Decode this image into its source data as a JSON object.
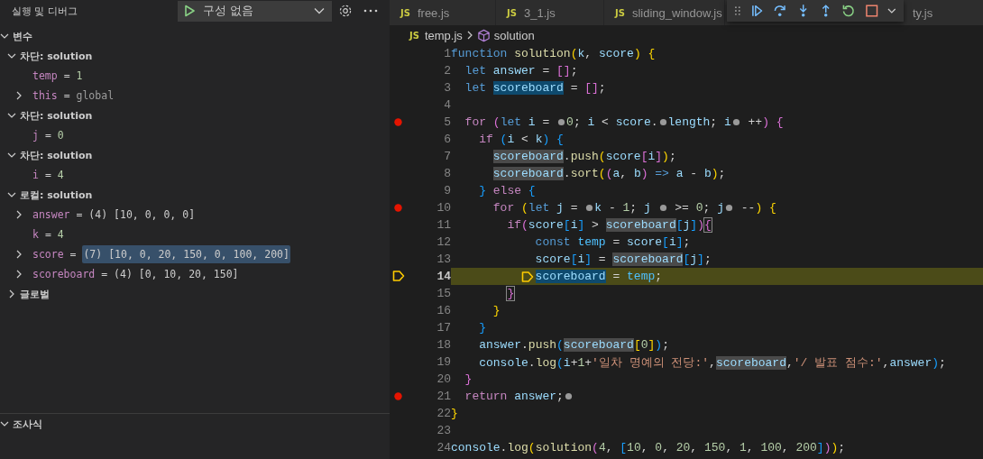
{
  "sidebar": {
    "title": "실행 및 디버그",
    "config": {
      "label": "구성 없음"
    },
    "variables": {
      "label": "변수",
      "expanded": true,
      "children": [
        {
          "kind": "scope",
          "label": "차단: solution",
          "expanded": true,
          "children": [
            {
              "kind": "number",
              "name": "temp",
              "sep": "=",
              "value": "1",
              "selected": false
            },
            {
              "kind": "ref",
              "name": "this",
              "sep": "=",
              "value": "global",
              "expanded": false,
              "selected": false
            }
          ]
        },
        {
          "kind": "scope",
          "label": "차단: solution",
          "expanded": true,
          "children": [
            {
              "kind": "number",
              "name": "j",
              "sep": "=",
              "value": "0",
              "selected": false
            }
          ]
        },
        {
          "kind": "scope",
          "label": "차단: solution",
          "expanded": true,
          "children": [
            {
              "kind": "number",
              "name": "i",
              "sep": "=",
              "value": "4",
              "selected": false
            }
          ]
        },
        {
          "kind": "scope",
          "label": "로컬: solution",
          "expanded": true,
          "children": [
            {
              "kind": "object",
              "name": "answer",
              "sep": "=",
              "value": "(4) [10, 0, 0, 0]",
              "expanded": false,
              "selected": false
            },
            {
              "kind": "number",
              "name": "k",
              "sep": "=",
              "value": "4",
              "selected": false
            },
            {
              "kind": "object",
              "name": "score",
              "sep": "=",
              "value": "(7) [10, 0, 20, 150, 0, 100, 200]",
              "expanded": false,
              "selected": true
            },
            {
              "kind": "object",
              "name": "scoreboard",
              "sep": "=",
              "value": "(4) [0, 10, 20, 150]",
              "expanded": false,
              "selected": false
            }
          ]
        },
        {
          "kind": "scope",
          "label": "글로벌",
          "expanded": false
        }
      ]
    },
    "watch": {
      "label": "조사식",
      "expanded": true
    }
  },
  "tabs": [
    {
      "icon": "JS",
      "label": "free.js",
      "selected": false
    },
    {
      "icon": "JS",
      "label": "3_1.js",
      "selected": false
    },
    {
      "icon": "JS",
      "label": "sliding_window.js",
      "selected": false
    },
    {
      "label": "ty.js",
      "selected": false
    }
  ],
  "breadcrumb": {
    "icon": "JS",
    "file": "temp.js",
    "symbol": "solution"
  },
  "lines": [
    {
      "number": "1",
      "breakpoint": false,
      "current": false,
      "tokens": [
        {
          "text": "function ",
          "kind": "kw"
        },
        {
          "text": "solution",
          "kind": "fn"
        },
        {
          "text": "(",
          "kind": "br1"
        },
        {
          "text": "k",
          "kind": "var"
        },
        {
          "text": ", ",
          "kind": "plain"
        },
        {
          "text": "score",
          "kind": "var"
        },
        {
          "text": ")",
          "kind": "br1"
        },
        {
          "text": " {",
          "kind": "br1"
        }
      ]
    },
    {
      "number": "2",
      "breakpoint": false,
      "current": false,
      "tokens": [
        {
          "text": "  let ",
          "kind": "kw"
        },
        {
          "text": "answer",
          "kind": "var"
        },
        {
          "text": " = ",
          "kind": "plain"
        },
        {
          "text": "[]",
          "kind": "br2"
        },
        {
          "text": ";",
          "kind": "plain"
        }
      ]
    },
    {
      "number": "3",
      "breakpoint": false,
      "current": false,
      "tokens": [
        {
          "text": "  let ",
          "kind": "kw"
        },
        {
          "text": "scoreboard",
          "kind": "var-sel"
        },
        {
          "text": " = ",
          "kind": "plain"
        },
        {
          "text": "[]",
          "kind": "br2"
        },
        {
          "text": ";",
          "kind": "plain"
        }
      ]
    },
    {
      "number": "4",
      "breakpoint": false,
      "current": false
    },
    {
      "number": "5",
      "breakpoint": true,
      "current": false,
      "tokens": [
        {
          "text": "  for ",
          "kind": "ctl"
        },
        {
          "text": "(",
          "kind": "br2"
        },
        {
          "text": "let ",
          "kind": "kw"
        },
        {
          "text": "i",
          "kind": "var"
        },
        {
          "text": " = ",
          "kind": "plain"
        },
        {
          "kind": "hint"
        },
        {
          "text": "0",
          "kind": "num"
        },
        {
          "text": "; ",
          "kind": "plain"
        },
        {
          "text": "i",
          "kind": "var"
        },
        {
          "text": " < ",
          "kind": "plain"
        },
        {
          "text": "score",
          "kind": "var"
        },
        {
          "text": ".",
          "kind": "plain"
        },
        {
          "kind": "hint"
        },
        {
          "text": "length",
          "kind": "var"
        },
        {
          "text": "; ",
          "kind": "plain"
        },
        {
          "text": "i",
          "kind": "var"
        },
        {
          "kind": "hint"
        },
        {
          "text": " ++",
          "kind": "plain"
        },
        {
          "text": ")",
          "kind": "br2"
        },
        {
          "text": " {",
          "kind": "br2"
        }
      ]
    },
    {
      "number": "6",
      "breakpoint": false,
      "current": false,
      "tokens": [
        {
          "text": "    if ",
          "kind": "ctl"
        },
        {
          "text": "(",
          "kind": "br3"
        },
        {
          "text": "i",
          "kind": "var"
        },
        {
          "text": " < ",
          "kind": "plain"
        },
        {
          "text": "k",
          "kind": "var"
        },
        {
          "text": ")",
          "kind": "br3"
        },
        {
          "text": " {",
          "kind": "br3"
        }
      ]
    },
    {
      "number": "7",
      "breakpoint": false,
      "current": false,
      "tokens": [
        {
          "text": "      scoreboard",
          "kind": "var-ref"
        },
        {
          "text": ".",
          "kind": "plain"
        },
        {
          "text": "push",
          "kind": "fn"
        },
        {
          "text": "(",
          "kind": "br1"
        },
        {
          "text": "score",
          "kind": "var"
        },
        {
          "text": "[",
          "kind": "br2"
        },
        {
          "text": "i",
          "kind": "var"
        },
        {
          "text": "]",
          "kind": "br2"
        },
        {
          "text": ")",
          "kind": "br1"
        },
        {
          "text": ";",
          "kind": "plain"
        }
      ]
    },
    {
      "number": "8",
      "breakpoint": false,
      "current": false,
      "tokens": [
        {
          "text": "      scoreboard",
          "kind": "var-ref"
        },
        {
          "text": ".",
          "kind": "plain"
        },
        {
          "text": "sort",
          "kind": "fn"
        },
        {
          "text": "(",
          "kind": "br1"
        },
        {
          "text": "(",
          "kind": "br2"
        },
        {
          "text": "a",
          "kind": "var"
        },
        {
          "text": ", ",
          "kind": "plain"
        },
        {
          "text": "b",
          "kind": "var"
        },
        {
          "text": ")",
          "kind": "br2"
        },
        {
          "text": " => ",
          "kind": "kw"
        },
        {
          "text": "a",
          "kind": "var"
        },
        {
          "text": " - ",
          "kind": "plain"
        },
        {
          "text": "b",
          "kind": "var"
        },
        {
          "text": ")",
          "kind": "br1"
        },
        {
          "text": ";",
          "kind": "plain"
        }
      ]
    },
    {
      "number": "9",
      "breakpoint": false,
      "current": false,
      "tokens": [
        {
          "text": "    }",
          "kind": "br3"
        },
        {
          "text": " else ",
          "kind": "ctl"
        },
        {
          "text": "{",
          "kind": "br3"
        }
      ]
    },
    {
      "number": "10",
      "breakpoint": true,
      "current": false,
      "tokens": [
        {
          "text": "      for ",
          "kind": "ctl"
        },
        {
          "text": "(",
          "kind": "br1"
        },
        {
          "text": "let ",
          "kind": "kw"
        },
        {
          "text": "j",
          "kind": "var"
        },
        {
          "text": " = ",
          "kind": "plain"
        },
        {
          "kind": "hint"
        },
        {
          "text": "k",
          "kind": "var"
        },
        {
          "text": " - ",
          "kind": "plain"
        },
        {
          "text": "1",
          "kind": "num"
        },
        {
          "text": "; ",
          "kind": "plain"
        },
        {
          "text": "j ",
          "kind": "var"
        },
        {
          "kind": "hint"
        },
        {
          "text": " >= ",
          "kind": "plain"
        },
        {
          "text": "0",
          "kind": "num"
        },
        {
          "text": "; ",
          "kind": "plain"
        },
        {
          "text": "j",
          "kind": "var"
        },
        {
          "kind": "hint"
        },
        {
          "text": " --",
          "kind": "plain"
        },
        {
          "text": ")",
          "kind": "br1"
        },
        {
          "text": " {",
          "kind": "br1"
        }
      ]
    },
    {
      "number": "11",
      "breakpoint": false,
      "current": false,
      "tokens": [
        {
          "text": "        if",
          "kind": "ctl"
        },
        {
          "text": "(",
          "kind": "br2"
        },
        {
          "text": "score",
          "kind": "var"
        },
        {
          "text": "[",
          "kind": "br3"
        },
        {
          "text": "i",
          "kind": "var"
        },
        {
          "text": "]",
          "kind": "br3"
        },
        {
          "text": " > ",
          "kind": "plain"
        },
        {
          "text": "scoreboard",
          "kind": "var-ref"
        },
        {
          "text": "[",
          "kind": "br3"
        },
        {
          "text": "j",
          "kind": "var"
        },
        {
          "text": "]",
          "kind": "br3"
        },
        {
          "text": ")",
          "kind": "br2"
        },
        {
          "text": "{",
          "kind": "br2-match"
        }
      ]
    },
    {
      "number": "12",
      "breakpoint": false,
      "current": false,
      "tokens": [
        {
          "text": "            const ",
          "kind": "kw"
        },
        {
          "text": "temp",
          "kind": "const"
        },
        {
          "text": " = ",
          "kind": "plain"
        },
        {
          "text": "score",
          "kind": "var"
        },
        {
          "text": "[",
          "kind": "br3"
        },
        {
          "text": "i",
          "kind": "var"
        },
        {
          "text": "]",
          "kind": "br3"
        },
        {
          "text": ";",
          "kind": "plain"
        }
      ]
    },
    {
      "number": "13",
      "breakpoint": false,
      "current": false,
      "tokens": [
        {
          "text": "            score",
          "kind": "var"
        },
        {
          "text": "[",
          "kind": "br3"
        },
        {
          "text": "i",
          "kind": "var"
        },
        {
          "text": "]",
          "kind": "br3"
        },
        {
          "text": " = ",
          "kind": "plain"
        },
        {
          "text": "scoreboard",
          "kind": "var-ref"
        },
        {
          "text": "[",
          "kind": "br3"
        },
        {
          "text": "j",
          "kind": "var"
        },
        {
          "text": "]",
          "kind": "br3"
        },
        {
          "text": ";",
          "kind": "plain"
        }
      ]
    },
    {
      "number": "14",
      "breakpoint": false,
      "current": true,
      "tokens": [
        {
          "kind": "stop"
        },
        {
          "text": "            scoreboard",
          "kind": "var-sel"
        },
        {
          "text": " = ",
          "kind": "plain"
        },
        {
          "text": "temp",
          "kind": "const"
        },
        {
          "text": ";",
          "kind": "plain"
        }
      ]
    },
    {
      "number": "15",
      "breakpoint": false,
      "current": false,
      "tokens": [
        {
          "text": "        }",
          "kind": "br2-match"
        }
      ]
    },
    {
      "number": "16",
      "breakpoint": false,
      "current": false,
      "tokens": [
        {
          "text": "      }",
          "kind": "br1"
        }
      ]
    },
    {
      "number": "17",
      "breakpoint": false,
      "current": false,
      "tokens": [
        {
          "text": "    }",
          "kind": "br3"
        }
      ]
    },
    {
      "number": "18",
      "breakpoint": false,
      "current": false,
      "tokens": [
        {
          "text": "    answer",
          "kind": "var"
        },
        {
          "text": ".",
          "kind": "plain"
        },
        {
          "text": "push",
          "kind": "fn"
        },
        {
          "text": "(",
          "kind": "br3"
        },
        {
          "text": "scoreboard",
          "kind": "var-ref"
        },
        {
          "text": "[",
          "kind": "br1"
        },
        {
          "text": "0",
          "kind": "num"
        },
        {
          "text": "]",
          "kind": "br1"
        },
        {
          "text": ")",
          "kind": "br3"
        },
        {
          "text": ";",
          "kind": "plain"
        }
      ]
    },
    {
      "number": "19",
      "breakpoint": false,
      "current": false,
      "tokens": [
        {
          "text": "    console",
          "kind": "var"
        },
        {
          "text": ".",
          "kind": "plain"
        },
        {
          "text": "log",
          "kind": "fn"
        },
        {
          "text": "(",
          "kind": "br3"
        },
        {
          "text": "i",
          "kind": "var"
        },
        {
          "text": "+",
          "kind": "plain"
        },
        {
          "text": "1",
          "kind": "num"
        },
        {
          "text": "+",
          "kind": "plain"
        },
        {
          "text": "'일차 명예의 전당:'",
          "kind": "str"
        },
        {
          "text": ",",
          "kind": "plain"
        },
        {
          "text": "scoreboard",
          "kind": "var-ref"
        },
        {
          "text": ",",
          "kind": "plain"
        },
        {
          "text": "'/ 발표 점수:'",
          "kind": "str"
        },
        {
          "text": ",",
          "kind": "plain"
        },
        {
          "text": "answer",
          "kind": "var"
        },
        {
          "text": ")",
          "kind": "br3"
        },
        {
          "text": ";",
          "kind": "plain"
        }
      ]
    },
    {
      "number": "20",
      "breakpoint": false,
      "current": false,
      "tokens": [
        {
          "text": "  }",
          "kind": "br2"
        }
      ]
    },
    {
      "number": "21",
      "breakpoint": true,
      "current": false,
      "tokens": [
        {
          "text": "  return ",
          "kind": "ctl"
        },
        {
          "text": "answer",
          "kind": "var"
        },
        {
          "text": ";",
          "kind": "plain"
        },
        {
          "kind": "hint"
        }
      ]
    },
    {
      "number": "22",
      "breakpoint": false,
      "current": false,
      "tokens": [
        {
          "text": "}",
          "kind": "br1"
        }
      ]
    },
    {
      "number": "23",
      "breakpoint": false,
      "current": false
    },
    {
      "number": "24",
      "breakpoint": false,
      "current": false,
      "tokens": [
        {
          "text": "console",
          "kind": "var"
        },
        {
          "text": ".",
          "kind": "plain"
        },
        {
          "text": "log",
          "kind": "fn"
        },
        {
          "text": "(",
          "kind": "br1"
        },
        {
          "text": "solution",
          "kind": "fn"
        },
        {
          "text": "(",
          "kind": "br2"
        },
        {
          "text": "4",
          "kind": "num"
        },
        {
          "text": ", ",
          "kind": "plain"
        },
        {
          "text": "[",
          "kind": "br3"
        },
        {
          "text": "10",
          "kind": "num"
        },
        {
          "text": ", ",
          "kind": "plain"
        },
        {
          "text": "0",
          "kind": "num"
        },
        {
          "text": ", ",
          "kind": "plain"
        },
        {
          "text": "20",
          "kind": "num"
        },
        {
          "text": ", ",
          "kind": "plain"
        },
        {
          "text": "150",
          "kind": "num"
        },
        {
          "text": ", ",
          "kind": "plain"
        },
        {
          "text": "1",
          "kind": "num"
        },
        {
          "text": ", ",
          "kind": "plain"
        },
        {
          "text": "100",
          "kind": "num"
        },
        {
          "text": ", ",
          "kind": "plain"
        },
        {
          "text": "200",
          "kind": "num"
        },
        {
          "text": "]",
          "kind": "br3"
        },
        {
          "text": ")",
          "kind": "br2"
        },
        {
          "text": ")",
          "kind": "br1"
        },
        {
          "text": ";",
          "kind": "plain"
        }
      ]
    }
  ]
}
